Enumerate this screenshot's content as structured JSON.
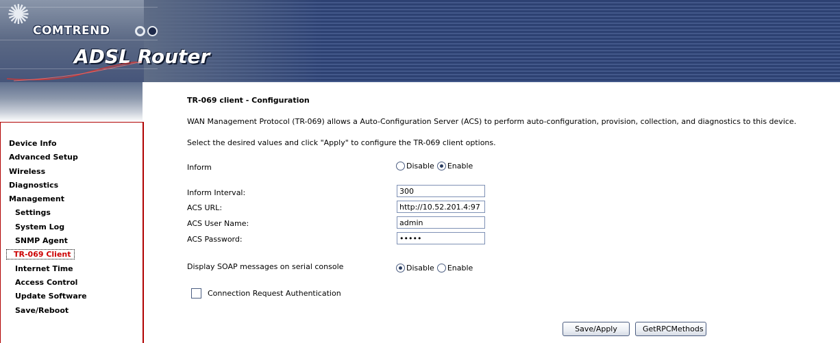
{
  "brand": {
    "company": "COMTREND",
    "product": "ADSL Router"
  },
  "nav": {
    "items": [
      {
        "label": "Device Info",
        "level": "top"
      },
      {
        "label": "Advanced Setup",
        "level": "top"
      },
      {
        "label": "Wireless",
        "level": "top"
      },
      {
        "label": "Diagnostics",
        "level": "top"
      },
      {
        "label": "Management",
        "level": "top"
      },
      {
        "label": "Settings",
        "level": "sub"
      },
      {
        "label": "System Log",
        "level": "sub"
      },
      {
        "label": "SNMP Agent",
        "level": "sub"
      },
      {
        "label": "TR-069 Client",
        "level": "sub",
        "active": true
      },
      {
        "label": "Internet Time",
        "level": "sub"
      },
      {
        "label": "Access Control",
        "level": "sub"
      },
      {
        "label": "Update Software",
        "level": "sub"
      },
      {
        "label": "Save/Reboot",
        "level": "sub"
      }
    ]
  },
  "page": {
    "title": "TR-069 client - Configuration",
    "desc1": "WAN Management Protocol (TR-069) allows a Auto-Configuration Server (ACS) to perform auto-configuration, provision, collection, and diagnostics to this device.",
    "desc2": "Select the desired values and click \"Apply\" to configure the TR-069 client options."
  },
  "form": {
    "inform": {
      "label": "Inform",
      "option_disable": "Disable",
      "option_enable": "Enable",
      "selected": "Enable"
    },
    "inform_interval": {
      "label": "Inform Interval:",
      "value": "300"
    },
    "acs_url": {
      "label": "ACS URL:",
      "value": "http://10.52.201.4:97"
    },
    "acs_user": {
      "label": "ACS User Name:",
      "value": "admin"
    },
    "acs_password": {
      "label": "ACS Password:",
      "value": "•••••"
    },
    "soap": {
      "label": "Display SOAP messages on serial console",
      "option_disable": "Disable",
      "option_enable": "Enable",
      "selected": "Disable"
    },
    "conn_auth": {
      "label": "Connection Request Authentication",
      "checked": false
    }
  },
  "buttons": {
    "save_apply": "Save/Apply",
    "get_rpc": "GetRPCMethods"
  },
  "colors": {
    "nav_border": "#b00000",
    "active_nav_text": "#cc0000",
    "banner": "#2d4172"
  }
}
